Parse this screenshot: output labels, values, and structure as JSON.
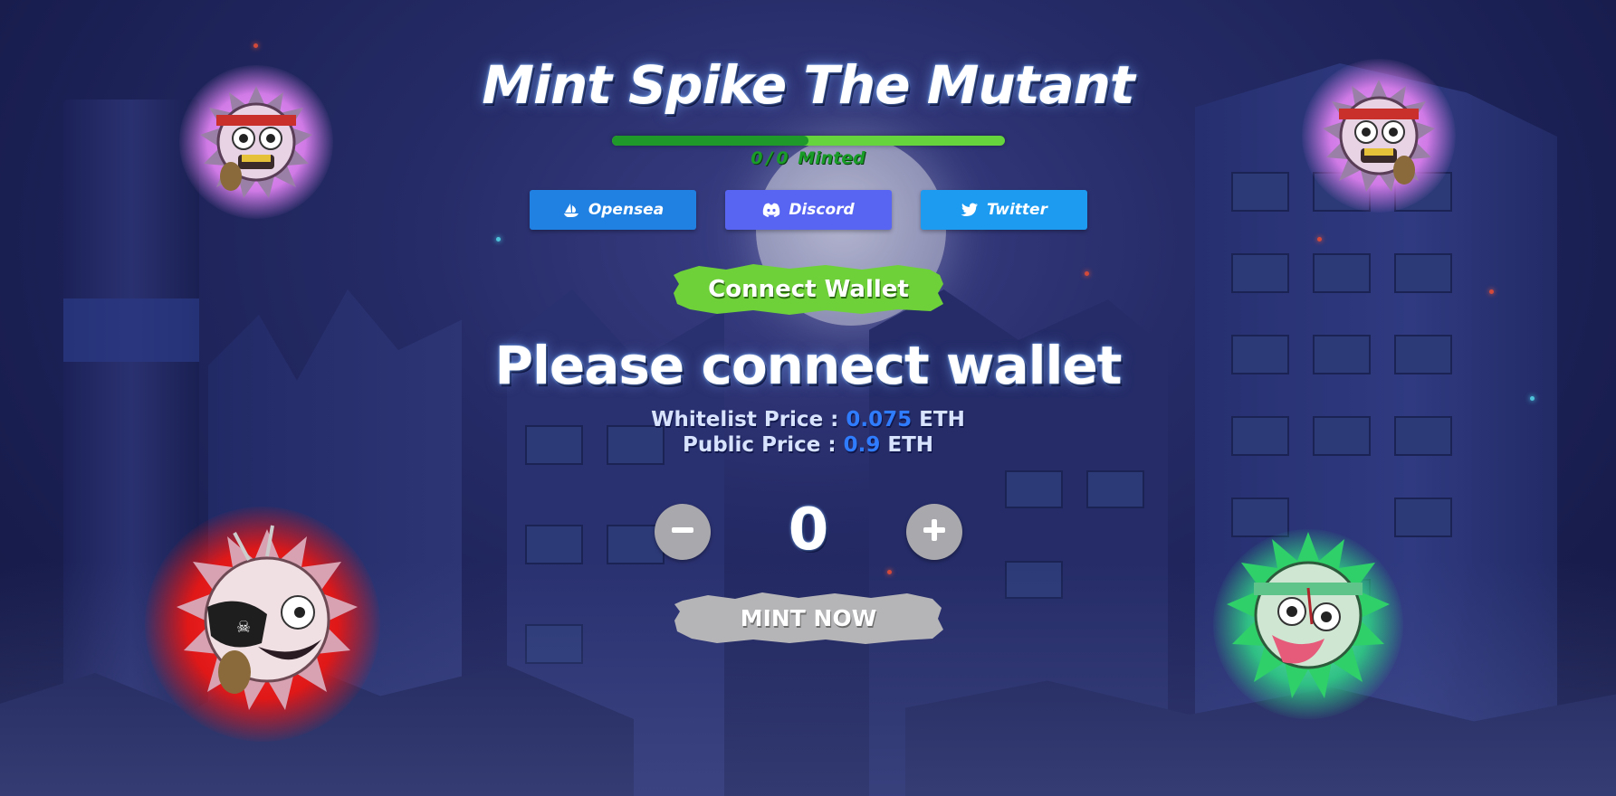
{
  "page": {
    "title": "Mint Spike The Mutant"
  },
  "progress": {
    "minted": "0",
    "separator": "/",
    "total": "0",
    "suffix": "Minted",
    "fill_fraction": 0.5
  },
  "links": [
    {
      "label": "Opensea",
      "icon": "opensea-icon",
      "color": "#2081e2"
    },
    {
      "label": "Discord",
      "icon": "discord-icon",
      "color": "#5865f2"
    },
    {
      "label": "Twitter",
      "icon": "twitter-icon",
      "color": "#1d9bf0"
    }
  ],
  "wallet": {
    "connect_label": "Connect Wallet",
    "status_text": "Please connect wallet"
  },
  "pricing": {
    "whitelist_label": "Whitelist Price :",
    "whitelist_value": "0.075",
    "public_label": "Public Price :",
    "public_value": "0.9",
    "unit": "ETH"
  },
  "quantity": {
    "value": "0",
    "decrement_icon": "minus-icon",
    "increment_icon": "plus-icon"
  },
  "mint": {
    "label": "MINT NOW"
  },
  "colors": {
    "accent_green": "#6ed13a",
    "progress_track": "#66d43c",
    "progress_fill": "#1f9a2a",
    "price_value": "#2f7cff",
    "mint_disabled": "#b5b5b8"
  }
}
